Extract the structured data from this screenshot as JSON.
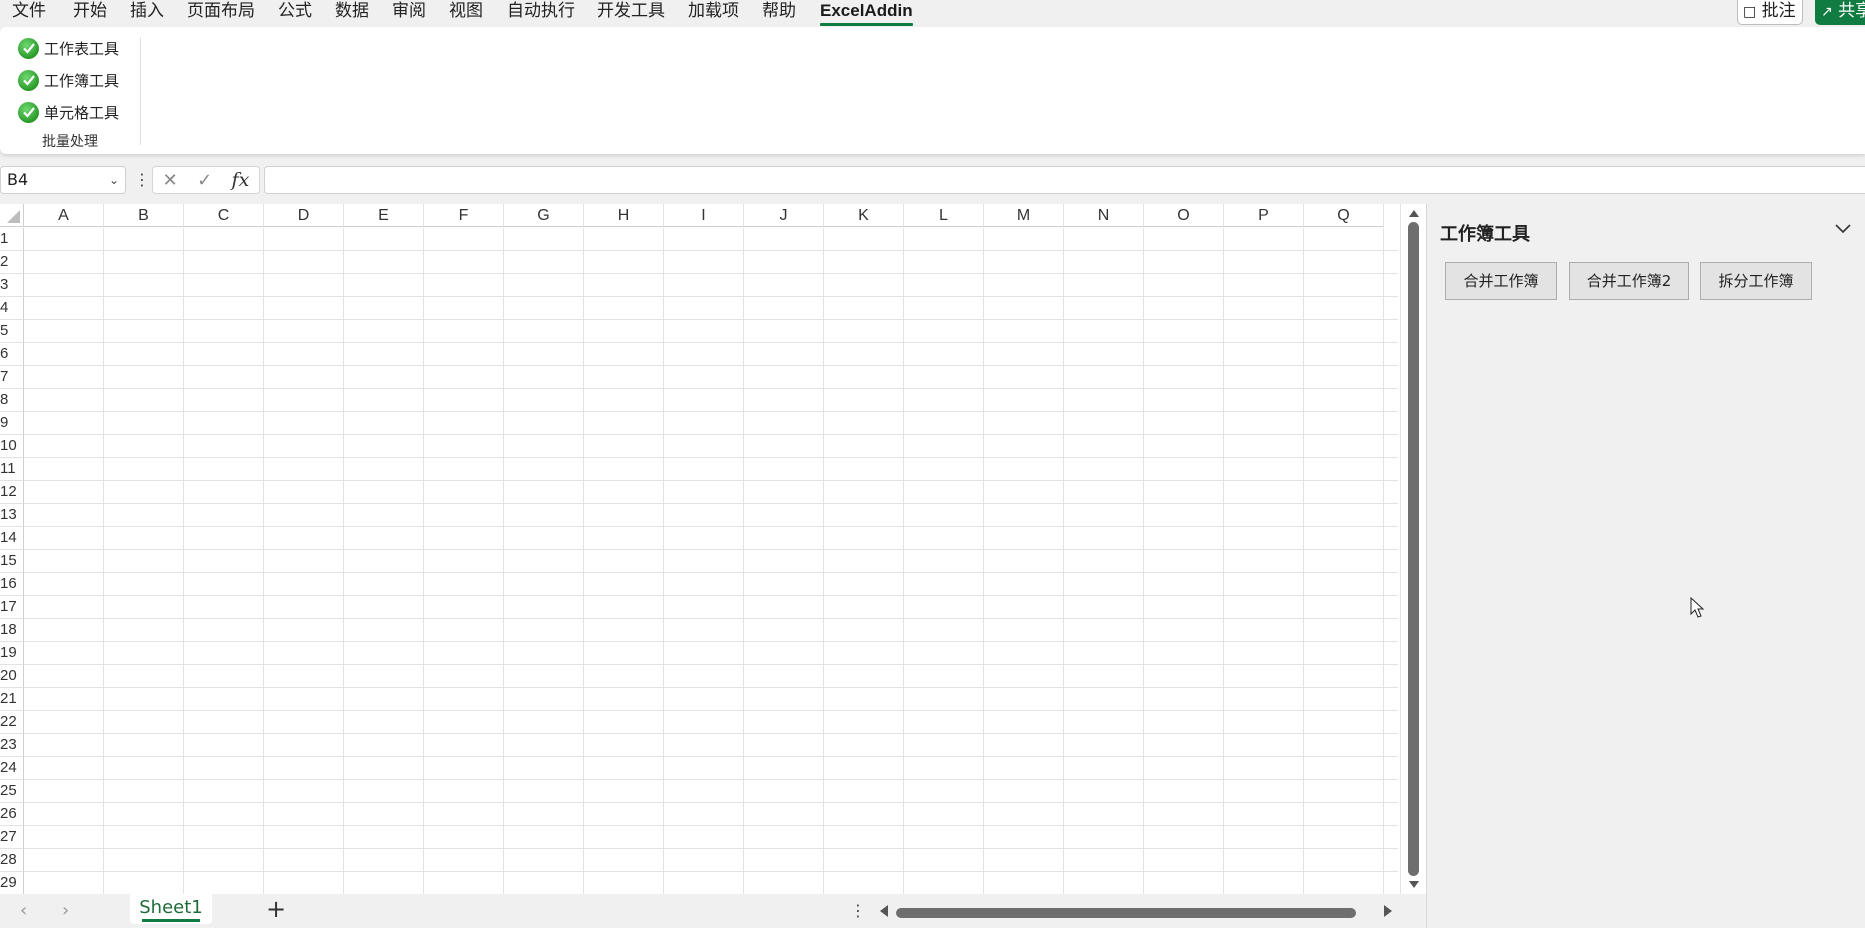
{
  "menu": {
    "items": [
      "文件",
      "开始",
      "插入",
      "页面布局",
      "公式",
      "数据",
      "审阅",
      "视图",
      "自动执行",
      "开发工具",
      "加载项",
      "帮助"
    ],
    "active_tab": "ExcelAddin",
    "comments_label": "批注",
    "share_label": "共享"
  },
  "ribbon": {
    "items": [
      "工作表工具",
      "工作簿工具",
      "单元格工具"
    ],
    "group_label": "批量处理"
  },
  "formula_bar": {
    "name_box": "B4",
    "fx_label": "fx",
    "formula_value": ""
  },
  "grid": {
    "columns": [
      "A",
      "B",
      "C",
      "D",
      "E",
      "F",
      "G",
      "H",
      "I",
      "J",
      "K",
      "L",
      "M",
      "N",
      "O",
      "P",
      "Q"
    ],
    "rows": [
      "1",
      "2",
      "3",
      "4",
      "5",
      "6",
      "7",
      "8",
      "9",
      "10",
      "11",
      "12",
      "13",
      "14",
      "15",
      "16",
      "17",
      "18",
      "19",
      "20",
      "21",
      "22",
      "23",
      "24",
      "25",
      "26",
      "27",
      "28",
      "29"
    ]
  },
  "sheets": {
    "tabs": [
      "Sheet1"
    ],
    "add_label": "+"
  },
  "taskpane": {
    "title": "工作簿工具",
    "buttons": [
      "合并工作簿",
      "合并工作簿2",
      "拆分工作簿"
    ]
  },
  "colors": {
    "accent": "#107c41",
    "check": "#2a9a2a"
  },
  "icons": [
    "check-icon",
    "chevron-down-icon",
    "comment-icon",
    "share-icon",
    "cancel-icon",
    "enter-icon",
    "fx-icon",
    "mouse-cursor-icon"
  ]
}
